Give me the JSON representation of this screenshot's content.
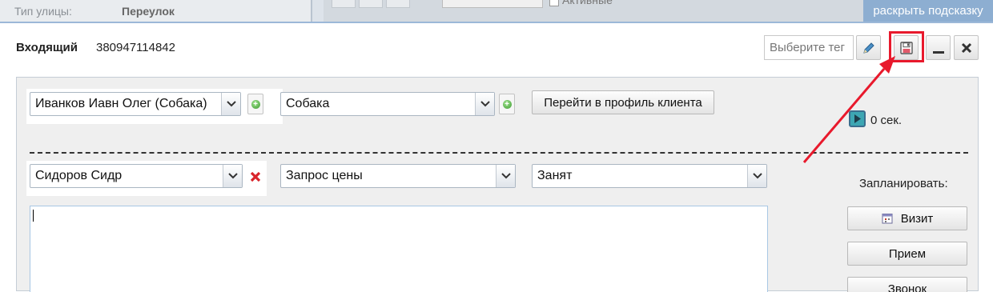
{
  "background": {
    "street_type_label": "Тип улицы:",
    "street_type_value": "Переулок",
    "active_label": "Активные",
    "hint_tab": "раскрыть подсказку"
  },
  "header": {
    "call_type": "Входящий",
    "phone": "380947114842",
    "tag_placeholder": "Выберите тег"
  },
  "row1": {
    "client_select": "Иванков Иавн Олег (Собака)",
    "pet_select": "Собака",
    "profile_button": "Перейти в профиль клиента",
    "timer": "0 сек."
  },
  "row2": {
    "employee_select": "Сидоров Сидр",
    "reason_select": "Запрос цены",
    "status_select": "Занят"
  },
  "comment": {
    "value": ""
  },
  "schedule": {
    "label": "Запланировать:",
    "visit_button": "Визит",
    "appointment_button": "Прием",
    "call_button": "Звонок"
  },
  "colors": {
    "accent_border": "#9cb8d8",
    "hint_tab_bg": "#8daed1",
    "highlight_red": "#e8192c",
    "remove_red": "#d9242b",
    "add_green": "#3e9b31"
  }
}
